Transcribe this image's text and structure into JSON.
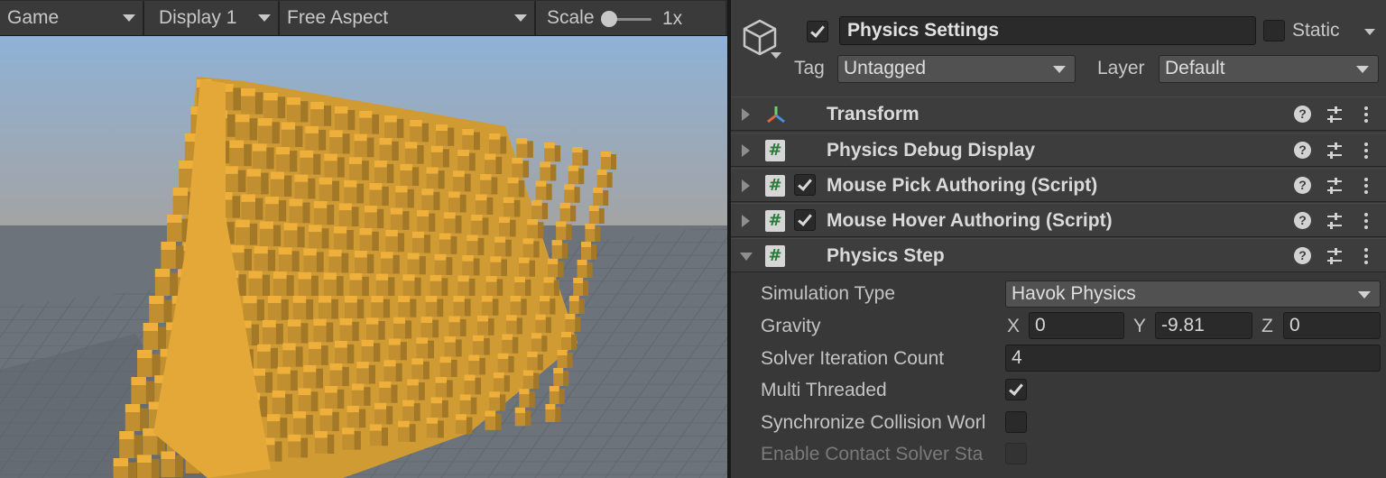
{
  "game_view": {
    "tab_label": "Game",
    "display_label": "Display 1",
    "aspect_label": "Free Aspect",
    "scale_label": "Scale",
    "scale_value": "1x",
    "colors": {
      "sky_top": "#8fb2d6",
      "horizon": "#a3a3a3",
      "ground": "#6d737a",
      "blocks": "#e3a838"
    }
  },
  "inspector": {
    "object_name": "Physics Settings",
    "active": true,
    "static_label": "Static",
    "static": false,
    "tag_label": "Tag",
    "tag_value": "Untagged",
    "layer_label": "Layer",
    "layer_value": "Default",
    "components": [
      {
        "label": "Transform",
        "icon": "transform-icon",
        "has_checkbox": false,
        "expanded": false
      },
      {
        "label": "Physics Debug Display",
        "icon": "script-icon",
        "has_checkbox": false,
        "expanded": false
      },
      {
        "label": "Mouse Pick Authoring (Script)",
        "icon": "script-icon",
        "has_checkbox": true,
        "checked": true,
        "expanded": false
      },
      {
        "label": "Mouse Hover Authoring (Script)",
        "icon": "script-icon",
        "has_checkbox": true,
        "checked": true,
        "expanded": false
      },
      {
        "label": "Physics Step",
        "icon": "script-icon",
        "has_checkbox": false,
        "expanded": true
      }
    ],
    "physics_step": {
      "simulation_type_label": "Simulation Type",
      "simulation_type_value": "Havok Physics",
      "gravity_label": "Gravity",
      "gravity_x_label": "X",
      "gravity_x": "0",
      "gravity_y_label": "Y",
      "gravity_y": "-9.81",
      "gravity_z_label": "Z",
      "gravity_z": "0",
      "solver_iteration_label": "Solver Iteration Count",
      "solver_iteration_value": "4",
      "multi_threaded_label": "Multi Threaded",
      "multi_threaded": true,
      "sync_collision_label": "Synchronize Collision Worl",
      "sync_collision": false,
      "contact_solver_label": "Enable Contact Solver Sta",
      "contact_solver": false
    }
  }
}
